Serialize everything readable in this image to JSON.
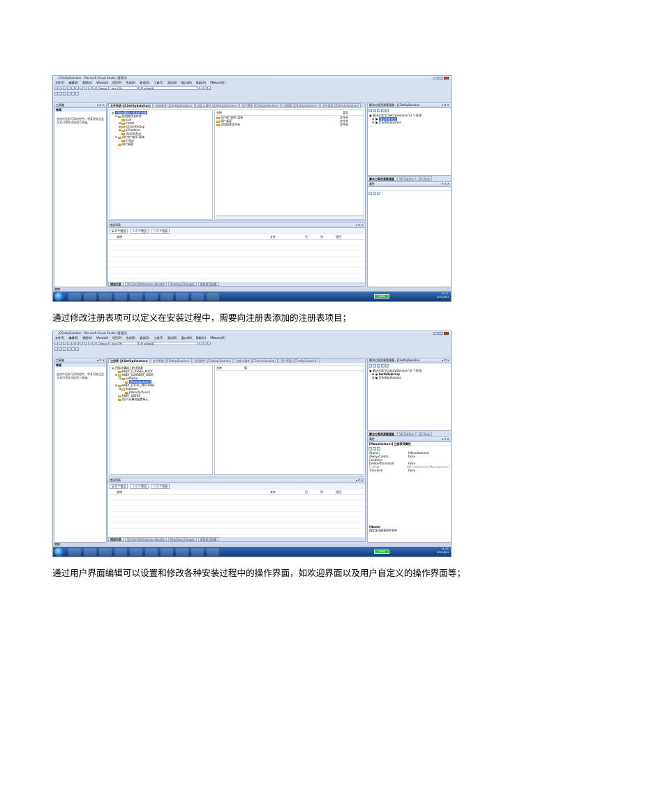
{
  "shot1": {
    "title": "JCSetUpSolution - Microsoft Visual Studio (管理员)",
    "menu": [
      "文件(F)",
      "编辑(E)",
      "视图(V)",
      "VAssistX",
      "项目(P)",
      "生成(B)",
      "调试(D)",
      "工具(T)",
      "测试(S)",
      "窗口(W)",
      "帮助(H)",
      "VMware(R)"
    ],
    "toolbar": {
      "config": "Debug",
      "platform": "Any CPU",
      "find": "pSsqlID"
    },
    "toolbox": {
      "title": "工具箱",
      "group": "常规",
      "empty_text": "此组中没有可用的控件。将某项拖至此文本可将其添加到工具箱。"
    },
    "tabs": [
      "文件系统 (JCSetUpSolution)",
      "启动条件 (JCSetUpSolution)",
      "自定义操作 (JCSetUpSolution)",
      "用户界面 (JCSetUpSolution)",
      "注册表 (JCSetUpSolution)",
      "文件类型 (JCSetUpSolution)"
    ],
    "tree_root": "目标计算机上的文件系统",
    "tree": [
      {
        "label": "应用程序文件夹",
        "level": 1,
        "toggle": "⊟"
      },
      {
        "label": "Icon",
        "level": 2,
        "toggle": ""
      },
      {
        "label": "Install",
        "level": 2,
        "toggle": "⊞"
      },
      {
        "label": "JCClientSetup",
        "level": 2,
        "toggle": "⊞"
      },
      {
        "label": "JCPlatform",
        "level": 2,
        "toggle": "⊞"
      },
      {
        "label": "UpdateRun",
        "level": 2,
        "toggle": ""
      },
      {
        "label": "用户的“程序”菜单",
        "level": 1,
        "toggle": "⊟"
      },
      {
        "label": "JCApp",
        "level": 2,
        "toggle": ""
      },
      {
        "label": "用户桌面",
        "level": 1,
        "toggle": ""
      }
    ],
    "list_headers": [
      "名称",
      "类型"
    ],
    "list_rows": [
      {
        "name": "用户的“程序”菜单",
        "type": "文件夹"
      },
      {
        "name": "用户桌面",
        "type": "文件夹"
      },
      {
        "name": "应用程序文件夹",
        "type": "文件夹"
      }
    ],
    "solution": {
      "title": "解决方案资源管理器 - JCSetUpSolution",
      "root": "解决方案“JCSetUpSolution”(2 个项目)",
      "items": [
        "InstallLibrary",
        "JCSetUpSolution"
      ],
      "tooltip": "显示所有文件"
    },
    "solution_tabs": [
      "解决方案资源管理器",
      "VA Outline",
      "VA View"
    ],
    "props_title": "属性",
    "errors": {
      "title": "错误列表",
      "filters": [
        "0 个错误",
        "0 个警告",
        "0 个消息"
      ],
      "headers": [
        "说明",
        "文件",
        "行",
        "列",
        "项目"
      ]
    },
    "bottom_tabs": [
      "错误列表",
      "VA Find References Results",
      "Pending Changes",
      "查找符号结果"
    ],
    "status": "就绪",
    "clock": {
      "time": "11:21",
      "date": "2014/8/4"
    },
    "battery": "100%"
  },
  "caption1": "通过修改注册表项可以定义在安装过程中，需要向注册表添加的注册表项目；",
  "shot2": {
    "title": "JCSetUpSolution - Microsoft Visual Studio (管理员)",
    "menu": [
      "文件(F)",
      "编辑(E)",
      "视图(V)",
      "VAssistX",
      "项目(P)",
      "生成(B)",
      "调试(D)",
      "工具(T)",
      "测试(S)",
      "窗口(W)",
      "帮助(H)",
      "VMware(R)"
    ],
    "toolbar": {
      "config": "Debug",
      "platform": "Any CPU",
      "find": "pSsqlID"
    },
    "toolbox": {
      "title": "工具箱",
      "group": "常规",
      "empty_text": "此组中没有可用的控件。将某项拖至此文本可将其添加到工具箱。"
    },
    "tabs": [
      "注册表 (JCSetUpSolution)",
      "文件系统 (JCSetUpSolution)",
      "启动条件 (JCSetUpSolution)",
      "自定义操作 (JCSetUpSolution)",
      "用户界面 (JCSetUpSolution)"
    ],
    "tree_root": "目标计算机上的注册表",
    "tree": [
      {
        "label": "HKEY_CLASSES_ROOT",
        "level": 1,
        "toggle": ""
      },
      {
        "label": "HKEY_CURRENT_USER",
        "level": 1,
        "toggle": "⊟"
      },
      {
        "label": "Software",
        "level": 2,
        "toggle": "⊟"
      },
      {
        "label": "[Manufacturer]",
        "level": 3,
        "toggle": "",
        "selected": true
      },
      {
        "label": "HKEY_LOCAL_MACHINE",
        "level": 1,
        "toggle": "⊟"
      },
      {
        "label": "Software",
        "level": 2,
        "toggle": "⊟"
      },
      {
        "label": "[Manufacturer]",
        "level": 3,
        "toggle": ""
      },
      {
        "label": "HKEY_USERS",
        "level": 1,
        "toggle": ""
      },
      {
        "label": "用户/计算机配置单元",
        "level": 1,
        "toggle": ""
      }
    ],
    "list_headers": [
      "名称",
      "值"
    ],
    "solution": {
      "title": "解决方案资源管理器 - JCSetUpSolution",
      "root": "解决方案“JCSetUpSolution”(2 个项目)",
      "items": [
        "InstallLibrary",
        "JCSetUpSolution"
      ]
    },
    "solution_tabs": [
      "解决方案资源管理器",
      "VA Outline",
      "VA View"
    ],
    "props_title": "属性",
    "props_object": "[Manufacturer] 注册表项属性",
    "props": [
      {
        "name": "(Name)",
        "value": "[Manufacturer]"
      },
      {
        "name": "AlwaysCreate",
        "value": "False"
      },
      {
        "name": "Condition",
        "value": ""
      },
      {
        "name": "DeleteAtUninstall",
        "value": "False"
      },
      {
        "name": "FullPath",
        "value": "HKCU\\Software\\[Manufacturer]"
      },
      {
        "name": "Transitive",
        "value": "False"
      }
    ],
    "props_desc_title": "(Name)",
    "props_desc": "指定该注册表项的名称",
    "errors": {
      "title": "错误列表",
      "filters": [
        "0 个错误",
        "0 个警告",
        "0 个消息"
      ],
      "headers": [
        "说明",
        "文件",
        "行",
        "列",
        "项目"
      ]
    },
    "bottom_tabs": [
      "错误列表",
      "VA Find References Results",
      "Pending Changes",
      "查找符号结果"
    ],
    "status": "就绪",
    "clock": {
      "time": "11:21",
      "date": "2014/8/4"
    },
    "battery": "100%"
  },
  "caption2": "通过用户界面编辑可以设置和修改各种安装过程中的操作界面，如欢迎界面以及用户自定义的操作界面等；"
}
